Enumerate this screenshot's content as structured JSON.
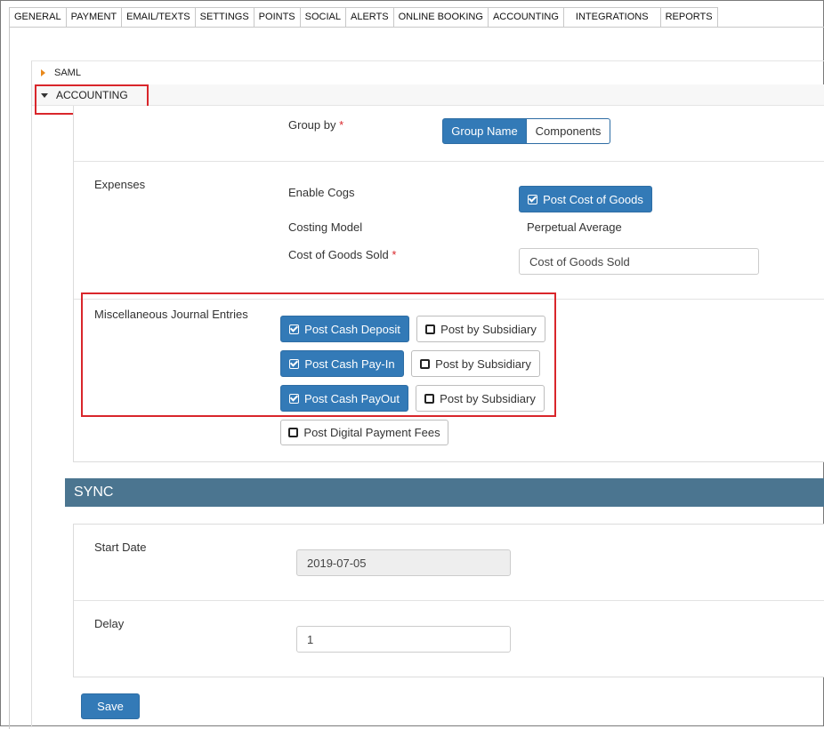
{
  "tabs": [
    "GENERAL",
    "PAYMENT",
    "EMAIL/TEXTS",
    "SETTINGS",
    "POINTS",
    "SOCIAL",
    "ALERTS",
    "ONLINE BOOKING",
    "ACCOUNTING",
    "INTEGRATIONS",
    "REPORTS"
  ],
  "sections": {
    "saml": "SAML",
    "accounting": "ACCOUNTING"
  },
  "group_by": {
    "label": "Group by",
    "required_mark": "*",
    "options": [
      "Group Name",
      "Components"
    ],
    "selected": "Group Name"
  },
  "expenses": {
    "label": "Expenses",
    "enable_cogs_label": "Enable Cogs",
    "enable_cogs_button": "Post Cost of Goods",
    "costing_model_label": "Costing Model",
    "costing_model_value": "Perpetual Average",
    "cogs_label": "Cost of Goods Sold",
    "required_mark": "*",
    "cogs_value": "Cost of Goods Sold"
  },
  "misc": {
    "label": "Miscellaneous Journal Entries",
    "post_cash_deposit": "Post Cash Deposit",
    "post_cash_payin": "Post Cash Pay-In",
    "post_cash_payout": "Post Cash PayOut",
    "post_by_subsidiary": "Post by Subsidiary",
    "post_digital_fees": "Post Digital Payment Fees"
  },
  "sync": {
    "title": "SYNC",
    "start_date_label": "Start Date",
    "start_date_value": "2019-07-05",
    "delay_label": "Delay",
    "delay_value": "1"
  },
  "save_label": "Save",
  "colors": {
    "primary": "#337ab7",
    "sync_header": "#4b7590",
    "highlight": "#d9262b",
    "saml_caret": "#e8891c"
  }
}
